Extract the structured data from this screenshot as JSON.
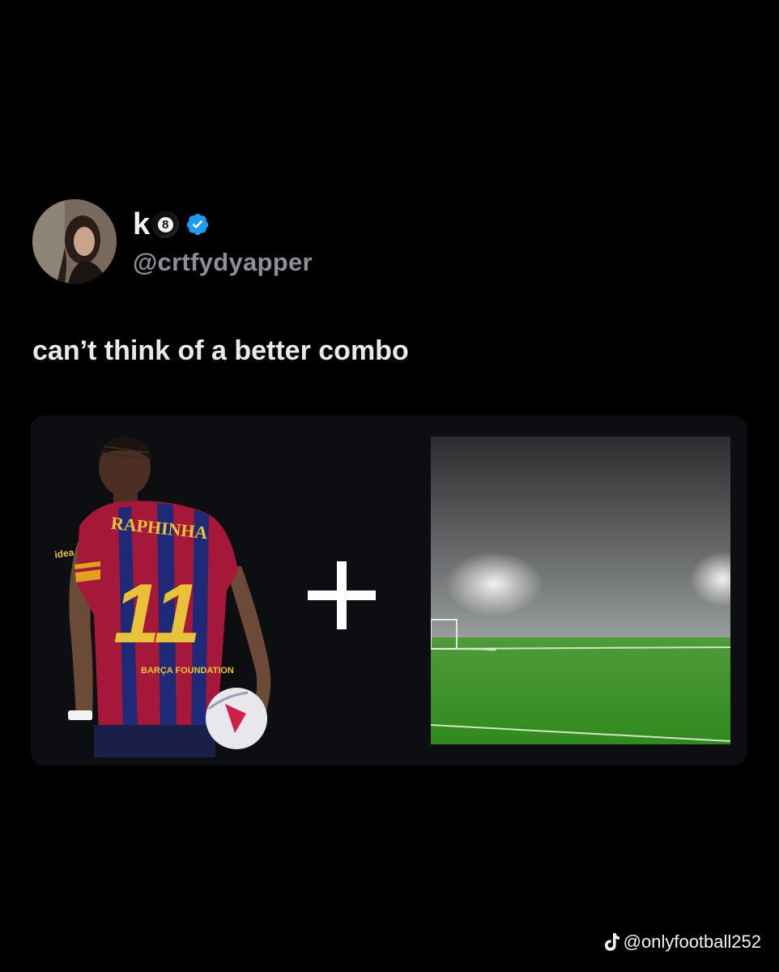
{
  "author": {
    "display_name": "k",
    "badge_number": "8",
    "handle": "@crtfydyapper",
    "verified": true
  },
  "tweet": {
    "text": "can’t think of a better combo"
  },
  "media": {
    "player_name": "RAPHINHA",
    "player_number": "11",
    "shirt_sponsor": "BARÇA FOUNDATION",
    "sleeve_text": "idea",
    "operator": "+"
  },
  "watermark": {
    "handle": "@onlyfootball252"
  },
  "colors": {
    "background": "#000000",
    "text": "#e9e9e9",
    "handle": "#8b9096",
    "verified": "#1d9bf0",
    "card": "#0d0e12"
  }
}
